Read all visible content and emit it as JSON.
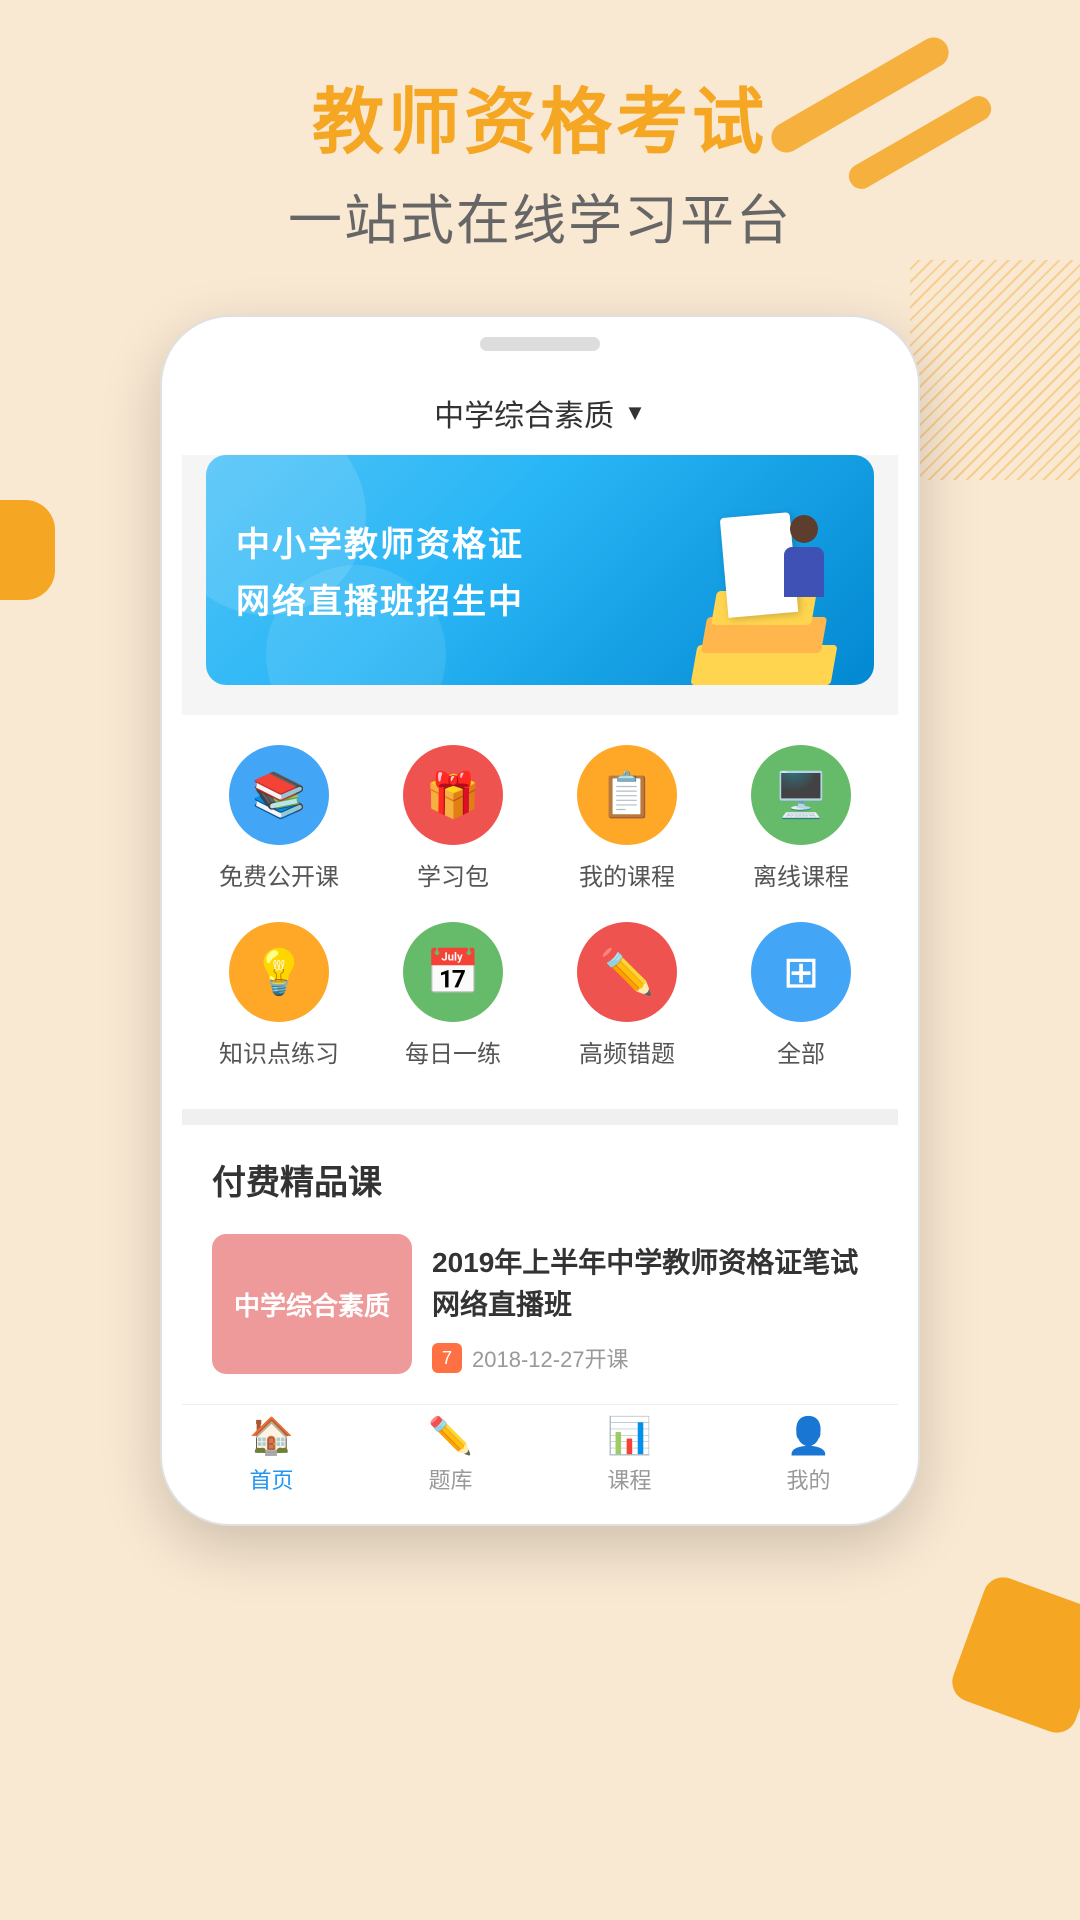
{
  "app": {
    "title": "教师资格考试",
    "subtitle": "一站式在线学习平台"
  },
  "screen": {
    "dropdown": {
      "label": "中学综合素质",
      "arrow": "▼"
    },
    "banner": {
      "line1": "中小学教师资格证",
      "line2": "网络直播班招生中"
    },
    "icons_row1": [
      {
        "label": "免费公开课",
        "icon": "📚",
        "color": "#42a5f5"
      },
      {
        "label": "学习包",
        "icon": "🎁",
        "color": "#ef5350"
      },
      {
        "label": "我的课程",
        "icon": "📋",
        "color": "#ffa726"
      },
      {
        "label": "离线课程",
        "icon": "🖥️",
        "color": "#66bb6a"
      }
    ],
    "icons_row2": [
      {
        "label": "知识点练习",
        "icon": "💡",
        "color": "#ffa726"
      },
      {
        "label": "每日一练",
        "icon": "📅",
        "color": "#66bb6a"
      },
      {
        "label": "高频错题",
        "icon": "✏️",
        "color": "#ef5350"
      },
      {
        "label": "全部",
        "icon": "⊞",
        "color": "#42a5f5"
      }
    ],
    "section_title": "付费精品课",
    "course_card": {
      "thumb_text": "中学综合素质",
      "thumb_color": "#ef9a9a",
      "name": "2019年上半年中学教师资格证笔试网络直播班",
      "date_icon": "7",
      "date": "2018-12-27开课"
    }
  },
  "bottom_nav": [
    {
      "label": "首页",
      "icon": "🏠",
      "active": true
    },
    {
      "label": "题库",
      "icon": "✏️",
      "active": false
    },
    {
      "label": "课程",
      "icon": "📊",
      "active": false
    },
    {
      "label": "我的",
      "icon": "👤",
      "active": false
    }
  ]
}
